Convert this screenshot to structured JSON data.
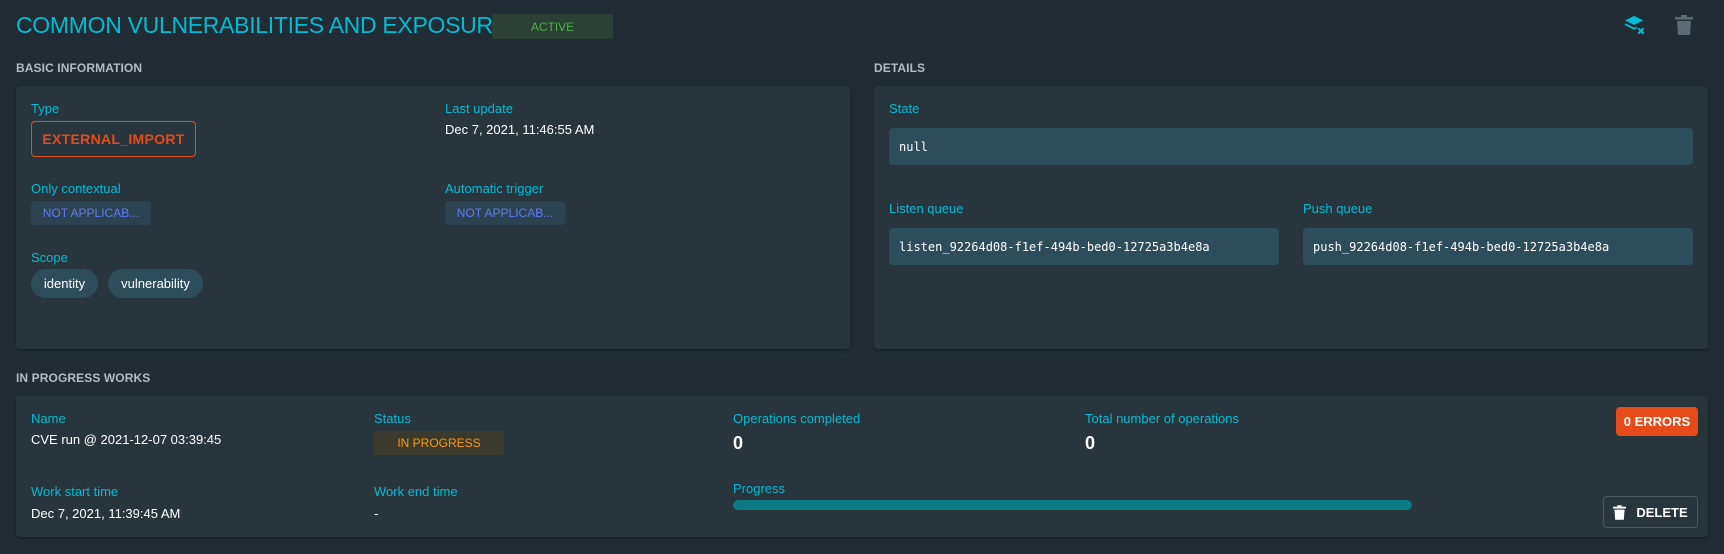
{
  "header": {
    "title": "COMMON VULNERABILITIES AND EXPOSURES",
    "status_badge": "ACTIVE",
    "icons": [
      "clear-works-icon",
      "delete-icon"
    ]
  },
  "basic_information": {
    "section_title": "BASIC INFORMATION",
    "type_label": "Type",
    "type_value": "EXTERNAL_IMPORT",
    "last_update_label": "Last update",
    "last_update_value": "Dec 7, 2021, 11:46:55 AM",
    "only_contextual_label": "Only contextual",
    "only_contextual_value": "NOT APPLICAB...",
    "automatic_trigger_label": "Automatic trigger",
    "automatic_trigger_value": "NOT APPLICAB...",
    "scope_label": "Scope",
    "scope_values": [
      "identity",
      "vulnerability"
    ]
  },
  "details": {
    "section_title": "DETAILS",
    "state_label": "State",
    "state_value": "null",
    "listen_queue_label": "Listen queue",
    "listen_queue_value": "listen_92264d08-f1ef-494b-bed0-12725a3b4e8a",
    "push_queue_label": "Push queue",
    "push_queue_value": "push_92264d08-f1ef-494b-bed0-12725a3b4e8a"
  },
  "works": {
    "section_title": "IN PROGRESS WORKS",
    "name_label": "Name",
    "name_value": "CVE run @ 2021-12-07 03:39:45",
    "status_label": "Status",
    "status_value": "IN PROGRESS",
    "ops_completed_label": "Operations completed",
    "ops_completed_value": "0",
    "total_ops_label": "Total number of operations",
    "total_ops_value": "0",
    "errors_button": "0 ERRORS",
    "start_time_label": "Work start time",
    "start_time_value": "Dec 7, 2021, 11:39:45 AM",
    "end_time_label": "Work end time",
    "end_time_value": "-",
    "progress_label": "Progress",
    "progress_fraction": 1.0,
    "delete_button": "DELETE"
  },
  "colors": {
    "background": "#212c35",
    "panel": "#29353d",
    "accent": "#00bcd4",
    "status_active": "#4caf50",
    "status_in_progress": "#ff9800",
    "danger": "#e64a19",
    "chip_link": "#5c7bf5"
  }
}
